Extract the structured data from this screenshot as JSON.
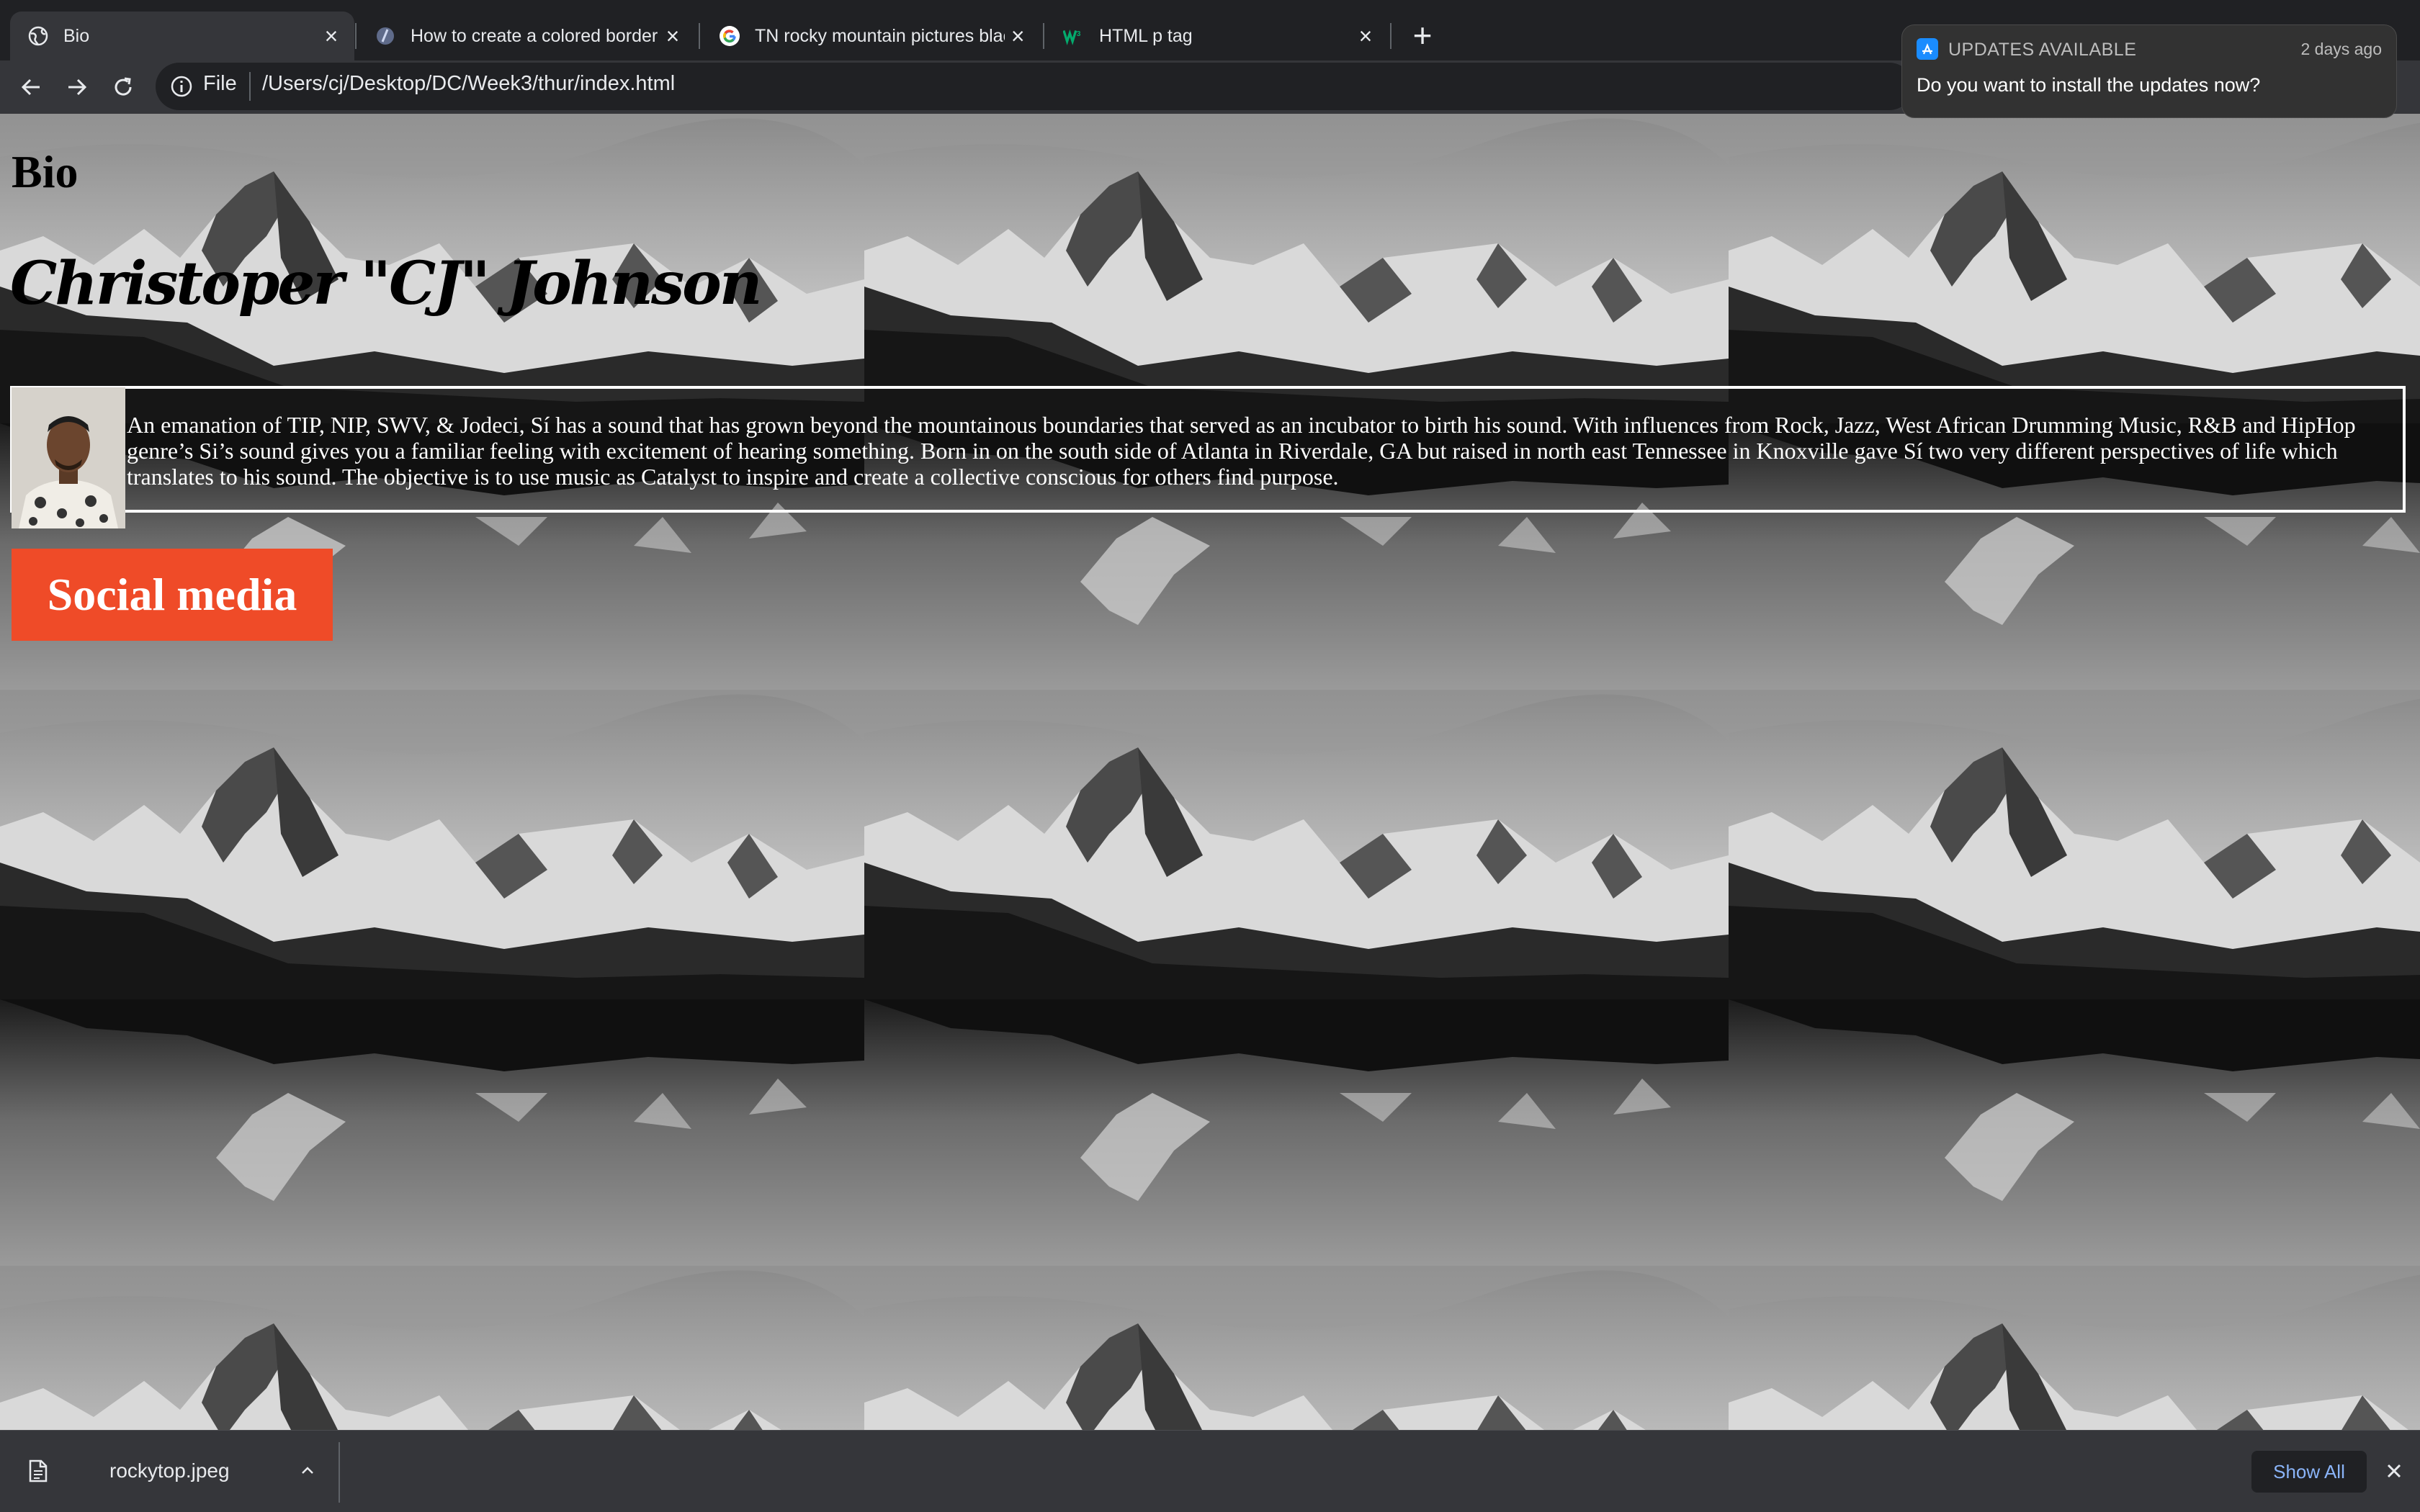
{
  "browser": {
    "tabs": [
      {
        "title": "Bio",
        "active": true,
        "icon": "globe-icon"
      },
      {
        "title": "How to create a colored border",
        "active": false,
        "icon": "site-icon"
      },
      {
        "title": "TN rocky mountain pictures black",
        "active": false,
        "icon": "google-icon"
      },
      {
        "title": "HTML p tag",
        "active": false,
        "icon": "w3schools-icon"
      }
    ],
    "omnibox": {
      "scheme_label": "File",
      "url": "/Users/cj/Desktop/DC/Week3/thur/index.html"
    }
  },
  "page": {
    "heading": "Bio",
    "name": "Christoper \"CJ\" Johnson",
    "bio": "An emanation of TIP, NIP, SWV, & Jodeci, Sí has a sound that has grown beyond the mountainous boundaries that served as an incubator to birth his sound. With influences from Rock, Jazz, West African Drumming Music, R&B and HipHop genre’s Si’s sound gives you a familiar feeling with excitement of hearing something. Born in on the south side of Atlanta in Riverdale, GA but raised in north east Tennessee in Knoxville gave Sí two very different perspectives of life which translates to his sound. The objective is to use music as Catalyst to inspire and create a collective conscious for others find purpose.",
    "social_button": "Social media",
    "social_button_color": "#ef4b28"
  },
  "notification": {
    "title": "UPDATES AVAILABLE",
    "time": "2 days ago",
    "body": "Do you want to install the updates now?"
  },
  "downloads": {
    "file_name": "rockytop.jpeg",
    "show_all": "Show All"
  }
}
